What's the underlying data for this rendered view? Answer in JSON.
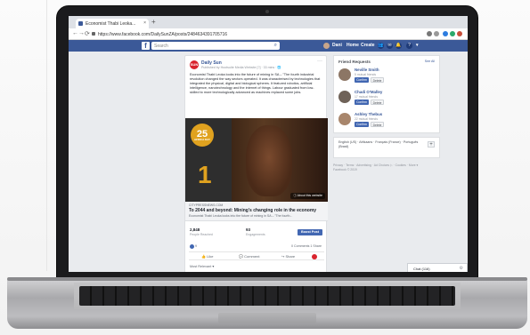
{
  "browser": {
    "tab_title": "Economist Thabi Leoka...",
    "tab_close": "×",
    "new_tab": "+",
    "url": "https://www.facebook.com/DailySunZA/posts/2484634391705716",
    "back": "←",
    "forward": "→",
    "reload": "⟳"
  },
  "facebook": {
    "logo": "f",
    "search_placeholder": "Search",
    "user_name": "Dani",
    "nav": [
      "Home",
      "Create"
    ],
    "notification_glyphs": [
      "👥",
      "✉",
      "🔔",
      "?"
    ]
  },
  "post": {
    "page_logo_text": "SUN",
    "page_name": "Daily Sun",
    "meta": "Published by Hootsuite Media Website [?] · 33 mins · 🌐",
    "menu": "···",
    "text": "Economist Thabi Leoka looks into the future of mining in SA – \"The fourth industrial revolution changed the way sectors operated. It was characterised by technologies that integrated the physical, digital and biological spheres. It featured robotics, artificial intelligence, nanotechnology and the internet of things. Labour graduated from low-skilled to more technologically advanced as machines replaced some jobs.",
    "image": {
      "badge_number": "25",
      "badge_caption": "AFRICA DAY",
      "big_number": "1",
      "about_site": "ⓘ About this website"
    },
    "link": {
      "domain": "CITYPRESSNEWS.COM",
      "title": "To 2044 and beyond: Mining's changing role in the economy",
      "description": "Economist Thabi Leoka looks into the future of mining in SA – \"The fourth..."
    },
    "insights": {
      "reached_value": "2,848",
      "reached_label": "People Reached",
      "engagements_value": "93",
      "engagements_label": "Engagements",
      "boost_label": "Boost Post"
    },
    "reactions_count": "9",
    "comments_shares": "0 Comments  1 Share",
    "actions": [
      "👍 Like",
      "💬 Comment",
      "↪ Share"
    ],
    "most_relevant": "Most Relevant ▾"
  },
  "friend_requests": {
    "title": "Friend Requests",
    "see_all": "See All",
    "confirm_label": "Confirm",
    "delete_label": "Delete",
    "items": [
      {
        "name": "Neville Smith",
        "mutual": "5 mutual friends"
      },
      {
        "name": "Chadi O'Malley",
        "mutual": "17 mutual friends"
      },
      {
        "name": "Ashley Thebus",
        "mutual": "22 mutual friends"
      }
    ]
  },
  "languages": {
    "text": "English (US) · Afrikaans · Français (France) · Português (Brasil)",
    "add": "+"
  },
  "footer": {
    "text": "Privacy · Terms · Advertising · Ad Choices ▷ · Cookies · More ▾",
    "copyright": "Facebook © 2019"
  },
  "chat": {
    "label": "Chat (116)",
    "settings": "⚙"
  },
  "colors": {
    "facebook_blue": "#3b5998",
    "link_blue": "#385898",
    "button_blue": "#4267b2",
    "sun_red": "#d9232d",
    "badge_gold": "#e0a21f"
  }
}
